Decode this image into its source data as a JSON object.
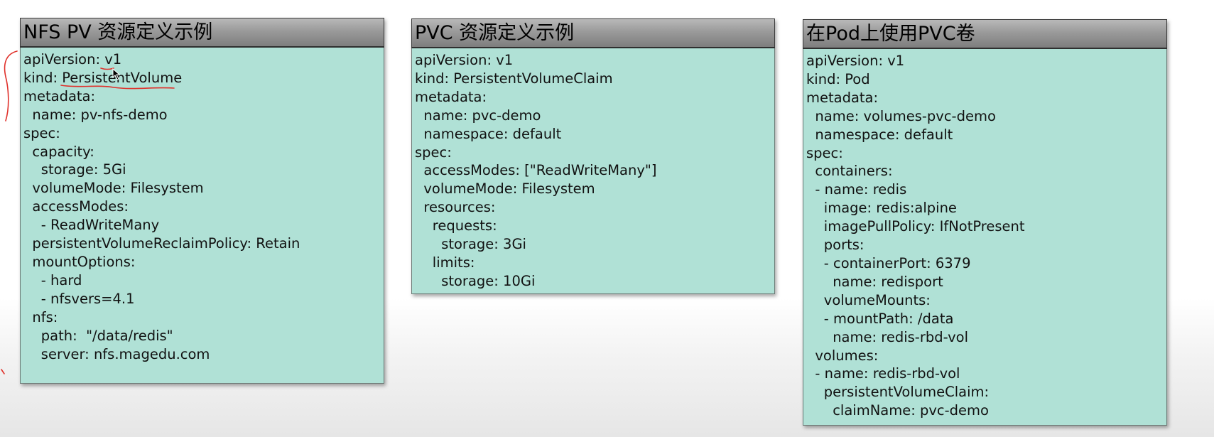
{
  "panels": [
    {
      "title": "NFS PV 资源定义示例",
      "lines": [
        "apiVersion: v1",
        "kind: PersistentVolume",
        "metadata:",
        "  name: pv-nfs-demo",
        "spec:",
        "  capacity:",
        "    storage: 5Gi",
        "  volumeMode: Filesystem",
        "  accessModes:",
        "    - ReadWriteMany",
        "  persistentVolumeReclaimPolicy: Retain",
        "  mountOptions:",
        "    - hard",
        "    - nfsvers=4.1",
        "  nfs:",
        "    path:  \"/data/redis\"",
        "    server: nfs.magedu.com"
      ]
    },
    {
      "title": "PVC 资源定义示例",
      "lines": [
        "apiVersion: v1",
        "kind: PersistentVolumeClaim",
        "metadata:",
        "  name: pvc-demo",
        "  namespace: default",
        "spec:",
        "  accessModes: [\"ReadWriteMany\"]",
        "  volumeMode: Filesystem",
        "  resources:",
        "    requests:",
        "      storage: 3Gi",
        "    limits:",
        "      storage: 10Gi"
      ]
    },
    {
      "title": "在Pod上使用PVC卷",
      "lines": [
        "apiVersion: v1",
        "kind: Pod",
        "metadata:",
        "  name: volumes-pvc-demo",
        "  namespace: default",
        "spec:",
        "  containers:",
        "  - name: redis",
        "    image: redis:alpine",
        "    imagePullPolicy: IfNotPresent",
        "    ports:",
        "    - containerPort: 6379",
        "      name: redisport",
        "    volumeMounts:",
        "    - mountPath: /data",
        "      name: redis-rbd-vol",
        "  volumes:",
        "  - name: redis-rbd-vol",
        "    persistentVolumeClaim:",
        "      claimName: pvc-demo"
      ]
    }
  ]
}
